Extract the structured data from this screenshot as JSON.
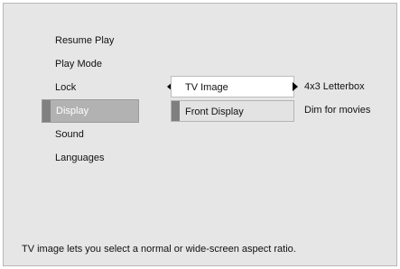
{
  "menu": {
    "items": [
      {
        "label": "Resume Play"
      },
      {
        "label": "Play Mode"
      },
      {
        "label": "Lock"
      },
      {
        "label": "Display"
      },
      {
        "label": "Sound"
      },
      {
        "label": "Languages"
      }
    ]
  },
  "submenu": {
    "items": [
      {
        "label": "TV Image",
        "value": "4x3 Letterbox"
      },
      {
        "label": "Front Display",
        "value": "Dim for movies"
      }
    ]
  },
  "status": {
    "text": "TV image lets you select a normal or wide-screen aspect ratio."
  }
}
